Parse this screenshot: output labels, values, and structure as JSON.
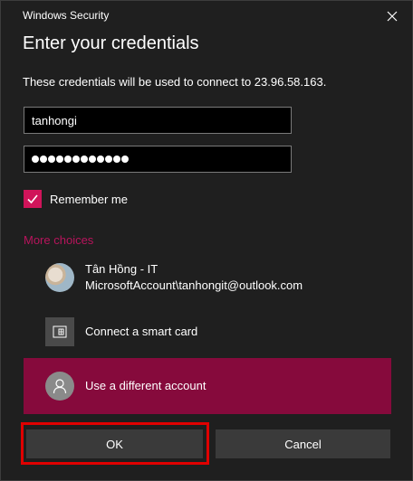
{
  "window": {
    "title": "Windows Security",
    "close_icon": "close-icon"
  },
  "dialog": {
    "heading": "Enter your credentials",
    "description": "These credentials will be used to connect to 23.96.58.163."
  },
  "form": {
    "username_value": "tanhongi",
    "password_mask_length": 12,
    "remember_label": "Remember me",
    "remember_checked": true
  },
  "more_choices": {
    "label": "More choices",
    "items": [
      {
        "icon": "user-photo-avatar",
        "line1": "Tân Hồng - IT",
        "line2": "MicrosoftAccount\\tanhongit@outlook.com"
      },
      {
        "icon": "smart-card-icon",
        "line1": "Connect a smart card"
      },
      {
        "icon": "person-icon",
        "line1": "Use a different account",
        "selected": true
      }
    ]
  },
  "buttons": {
    "ok_label": "OK",
    "cancel_label": "Cancel"
  },
  "colors": {
    "background": "#1f1f1f",
    "accent": "#d0145a",
    "selected_row": "#860a3c",
    "link": "#b8145c",
    "button": "#3a3a3a",
    "highlight_box": "#e00000"
  }
}
